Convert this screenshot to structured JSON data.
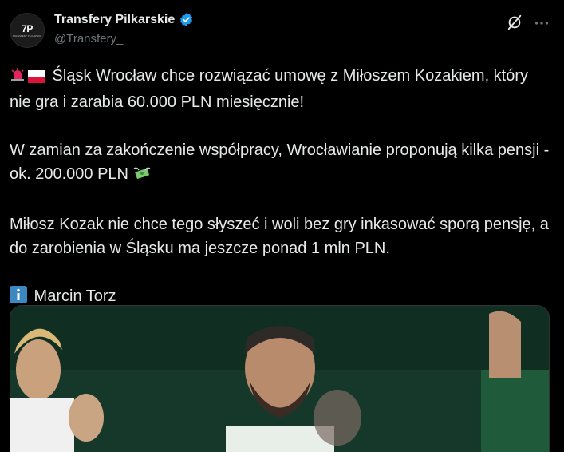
{
  "account": {
    "display_name": "Transfery Pilkarskie",
    "handle": "@Transfery_",
    "verified": true,
    "avatar_text_main": "7P",
    "avatar_text_sub": "TRANSFERY PILKARSKIE"
  },
  "icons": {
    "header": [
      "grok-icon",
      "more-icon"
    ],
    "inline": [
      "siren-icon",
      "poland-flag-icon",
      "money-wings-icon",
      "information-icon"
    ]
  },
  "tweet": {
    "line1": " Śląsk Wrocław chce rozwiązać umowę z Miłoszem Kozakiem, który nie gra i zarabia 60.000 PLN miesięcznie!",
    "para2": "W zamian za zakończenie współpracy, Wrocławianie proponują kilka pensji - ok. 200.000 PLN",
    "para3": "Miłosz Kozak nie chce tego słyszeć i woli bez gry inkasować sporą pensję, a do zarobienia w Śląsku ma jeszcze ponad 1 mln PLN.",
    "para4": " Marcin Torz"
  },
  "colors": {
    "background": "#000000",
    "text": "#e7e9ea",
    "secondary_text": "#71767b",
    "verified_blue": "#1d9bf0"
  }
}
